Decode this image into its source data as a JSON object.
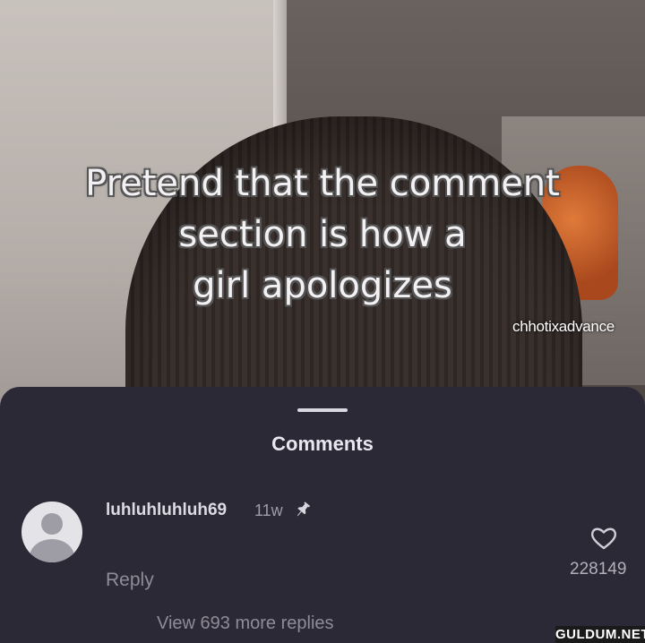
{
  "video": {
    "caption_lines": [
      "Pretend that the comment",
      "section is how a",
      "girl apologizes"
    ],
    "watermark": "chhotixadvance"
  },
  "comments_sheet": {
    "title": "Comments",
    "comment": {
      "username": "luhluhluhluh69",
      "time": "11w",
      "reply_label": "Reply",
      "like_count": "228149",
      "view_replies": "View 693 more replies"
    }
  },
  "site_badge": "GULDUM.NET",
  "colors": {
    "sheet_bg": "#2c2936",
    "caption_text": "#f3f1f3",
    "muted_text": "#8f8c98"
  },
  "icons": {
    "pin": "pin-icon",
    "heart": "heart-icon",
    "avatar": "default-avatar-icon"
  }
}
